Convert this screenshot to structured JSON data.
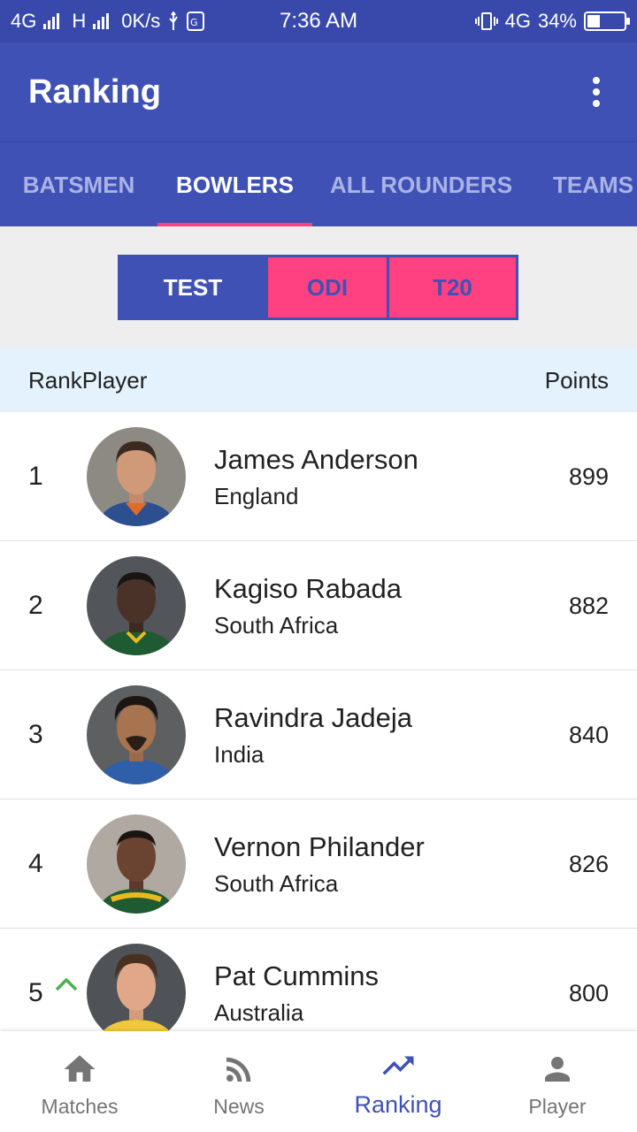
{
  "status_bar": {
    "network_left": "4G",
    "network_h": "H",
    "data_speed": "0K/s",
    "time": "7:36 AM",
    "network_right": "4G",
    "battery": "34%"
  },
  "app_bar": {
    "title": "Ranking",
    "menu_icon": "more-vert-icon"
  },
  "tabs": [
    {
      "label": "BATSMEN",
      "active": false
    },
    {
      "label": "BOWLERS",
      "active": true
    },
    {
      "label": "ALL ROUNDERS",
      "active": false
    },
    {
      "label": "TEAMS",
      "active": false
    }
  ],
  "format_filter": {
    "options": [
      "TEST",
      "ODI",
      "T20"
    ],
    "selected": "TEST"
  },
  "table_header": {
    "rank_player": "RankPlayer",
    "points": "Points"
  },
  "rankings": [
    {
      "rank": "1",
      "name": "James Anderson",
      "country": "England",
      "points": "899",
      "trend": ""
    },
    {
      "rank": "2",
      "name": "Kagiso Rabada",
      "country": "South Africa",
      "points": "882",
      "trend": ""
    },
    {
      "rank": "3",
      "name": "Ravindra Jadeja",
      "country": "India",
      "points": "840",
      "trend": ""
    },
    {
      "rank": "4",
      "name": "Vernon Philander",
      "country": "South Africa",
      "points": "826",
      "trend": ""
    },
    {
      "rank": "5",
      "name": "Pat Cummins",
      "country": "Australia",
      "points": "800",
      "trend": "up"
    }
  ],
  "bottom_nav": [
    {
      "label": "Matches",
      "icon": "home-icon",
      "active": false
    },
    {
      "label": "News",
      "icon": "rss-feed-icon",
      "active": false
    },
    {
      "label": "Ranking",
      "icon": "trending-up-icon",
      "active": true
    },
    {
      "label": "Player",
      "icon": "person-icon",
      "active": false
    }
  ],
  "colors": {
    "primary": "#3f51b5",
    "accent": "#ff4081",
    "status_bar": "#3949ab",
    "header_bg": "#e3f2fd",
    "trend_up": "#4caf50"
  }
}
